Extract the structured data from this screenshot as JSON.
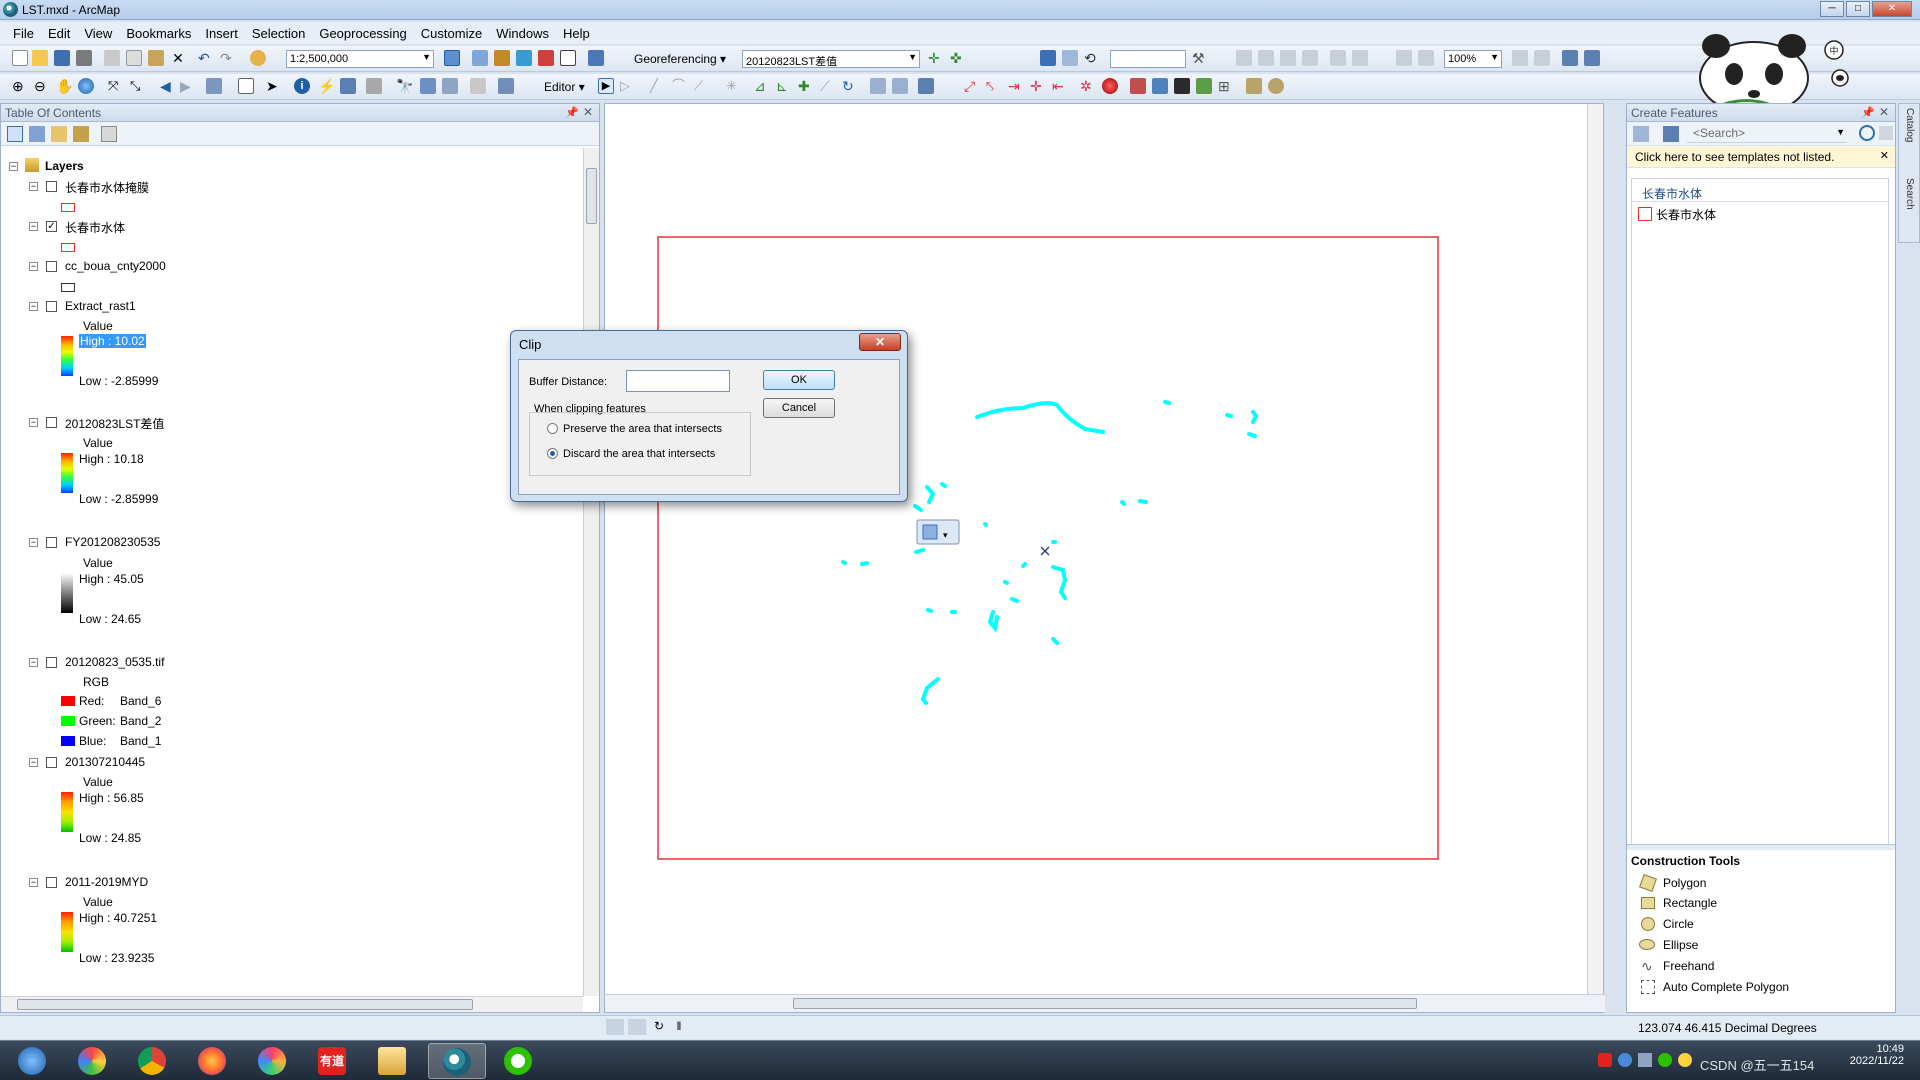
{
  "window": {
    "title": "LST.mxd - ArcMap",
    "btn_min": "─",
    "btn_max": "□",
    "btn_close": "✕"
  },
  "menu": [
    "File",
    "Edit",
    "View",
    "Bookmarks",
    "Insert",
    "Selection",
    "Geoprocessing",
    "Customize",
    "Windows",
    "Help"
  ],
  "toolbar": {
    "scale": "1:2,500,000",
    "georeferencing_label": "Georeferencing",
    "georef_layer": "20120823LST差值",
    "zoom_percent": "100%",
    "editor_label": "Editor"
  },
  "toc": {
    "title": "Table Of Contents",
    "root": "Layers",
    "layers": [
      {
        "name": "长春市水体掩膜"
      },
      {
        "name": "长春市水体"
      },
      {
        "name": "cc_boua_cnty2000"
      },
      {
        "name": "Extract_rast1",
        "field": "Value",
        "high": "High : 10.02",
        "low": "Low : -2.85999"
      },
      {
        "name": "20120823LST差值",
        "field": "Value",
        "high": "High : 10.18",
        "low": "Low : -2.85999"
      },
      {
        "name": "FY201208230535",
        "field": "Value",
        "high": "High : 45.05",
        "low": "Low : 24.65"
      },
      {
        "name": "20120823_0535.tif",
        "field": "RGB",
        "red_label": "Red:",
        "red_band": "Band_6",
        "green_label": "Green:",
        "green_band": "Band_2",
        "blue_label": "Blue:",
        "blue_band": "Band_1"
      },
      {
        "name": "201307210445",
        "field": "Value",
        "high": "High : 56.85",
        "low": "Low : 24.85"
      },
      {
        "name": "2011-2019MYD",
        "field": "Value",
        "high": "High : 40.7251",
        "low": "Low : 23.9235"
      }
    ]
  },
  "clip_dialog": {
    "title": "Clip",
    "close": "✕",
    "buffer_label": "Buffer Distance:",
    "buffer_value": "",
    "group_label": "When clipping features",
    "option_preserve": "Preserve the area that intersects",
    "option_discard": "Discard the area that intersects",
    "selected_option": "discard",
    "ok": "OK",
    "cancel": "Cancel"
  },
  "create_features": {
    "title": "Create Features",
    "search_placeholder": "<Search>",
    "notice": "Click here to see templates not listed.",
    "group": "长春市水体",
    "template": "长春市水体",
    "construction_title": "Construction Tools",
    "tools": [
      "Polygon",
      "Rectangle",
      "Circle",
      "Ellipse",
      "Freehand",
      "Auto Complete Polygon"
    ]
  },
  "side_tabs": [
    "Catalog",
    "Search"
  ],
  "status": {
    "coordinates": "123.074  46.415 Decimal Degrees"
  },
  "taskbar": {
    "time": "10:49",
    "date": "2022/11/22",
    "watermark": "CSDN @五一五154",
    "apps": [
      "start",
      "colorful",
      "chrome",
      "firefox",
      "pinwheel",
      "youdao",
      "explorer",
      "arcmap",
      "wechat"
    ],
    "youdao_label": "有道"
  },
  "colors": {
    "water": "#00ffff",
    "extent_border": "#e8303c",
    "selection": "#3399ff"
  }
}
